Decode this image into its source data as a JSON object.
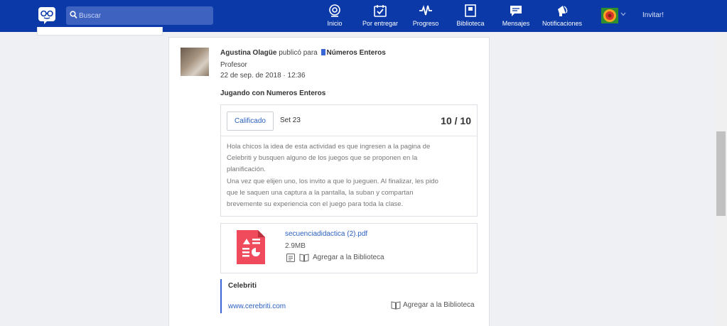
{
  "topbar": {
    "search_placeholder": "Buscar",
    "nav": [
      {
        "label": "Inicio",
        "icon": "home-icon"
      },
      {
        "label": "Por entregar",
        "icon": "calendar-check-icon"
      },
      {
        "label": "Progreso",
        "icon": "pulse-icon"
      },
      {
        "label": "Biblioteca",
        "icon": "library-icon"
      },
      {
        "label": "Mensajes",
        "icon": "chat-bubble-icon"
      },
      {
        "label": "Notificaciones",
        "icon": "megaphone-icon"
      }
    ],
    "invite": "Invitar!",
    "accent_color": "#0b3aa8"
  },
  "post": {
    "author": "Agustina Olagüe",
    "published_text": "publicó para",
    "group": "Números Enteros",
    "role": "Profesor",
    "date": "22 de sep. de 2018 · 12:36",
    "title": "Jugando con Numeros Enteros",
    "grade": {
      "status_button": "Calificado",
      "set": "Set 23",
      "score": "10 / 10"
    },
    "description": [
      "Hola chicos la idea de esta actividad es que ingresen a la pagina de",
      "Celebriti y busquen alguno de los juegos que se proponen en la",
      "planificación.",
      "Una vez que elijen uno, los invito a que lo jueguen. Al finalizar, les pido",
      "que le saquen una captura a la pantalla, la suban y compartan",
      "brevemente su experiencia con el juego para toda la clase."
    ],
    "attachment": {
      "filename": "secuenciadidactica (2).pdf",
      "size": "2.9MB",
      "add_to_library": "Agregar a la Biblioteca",
      "icon_color": "#ef4b5c"
    },
    "link": {
      "title": "Celebriti",
      "url": "www.cerebriti.com",
      "add_to_library": "Agregar a la Biblioteca"
    }
  }
}
